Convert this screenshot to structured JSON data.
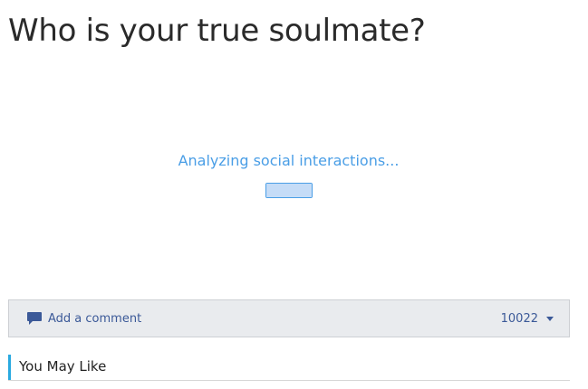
{
  "page": {
    "title": "Who is your true soulmate?"
  },
  "analysis": {
    "status_text": "Analyzing social interactions...",
    "progress_fraction": 1.0
  },
  "comments": {
    "add_label": "Add a comment",
    "count": "10022",
    "icon": "comment-bubble-icon",
    "caret_icon": "caret-down-icon"
  },
  "recommendations": {
    "heading": "You May Like"
  },
  "colors": {
    "accent_blue": "#4a9ee6",
    "facebook_blue": "#3b5998",
    "comment_bar_bg": "#e9ebee",
    "section_accent": "#29a9e0"
  }
}
